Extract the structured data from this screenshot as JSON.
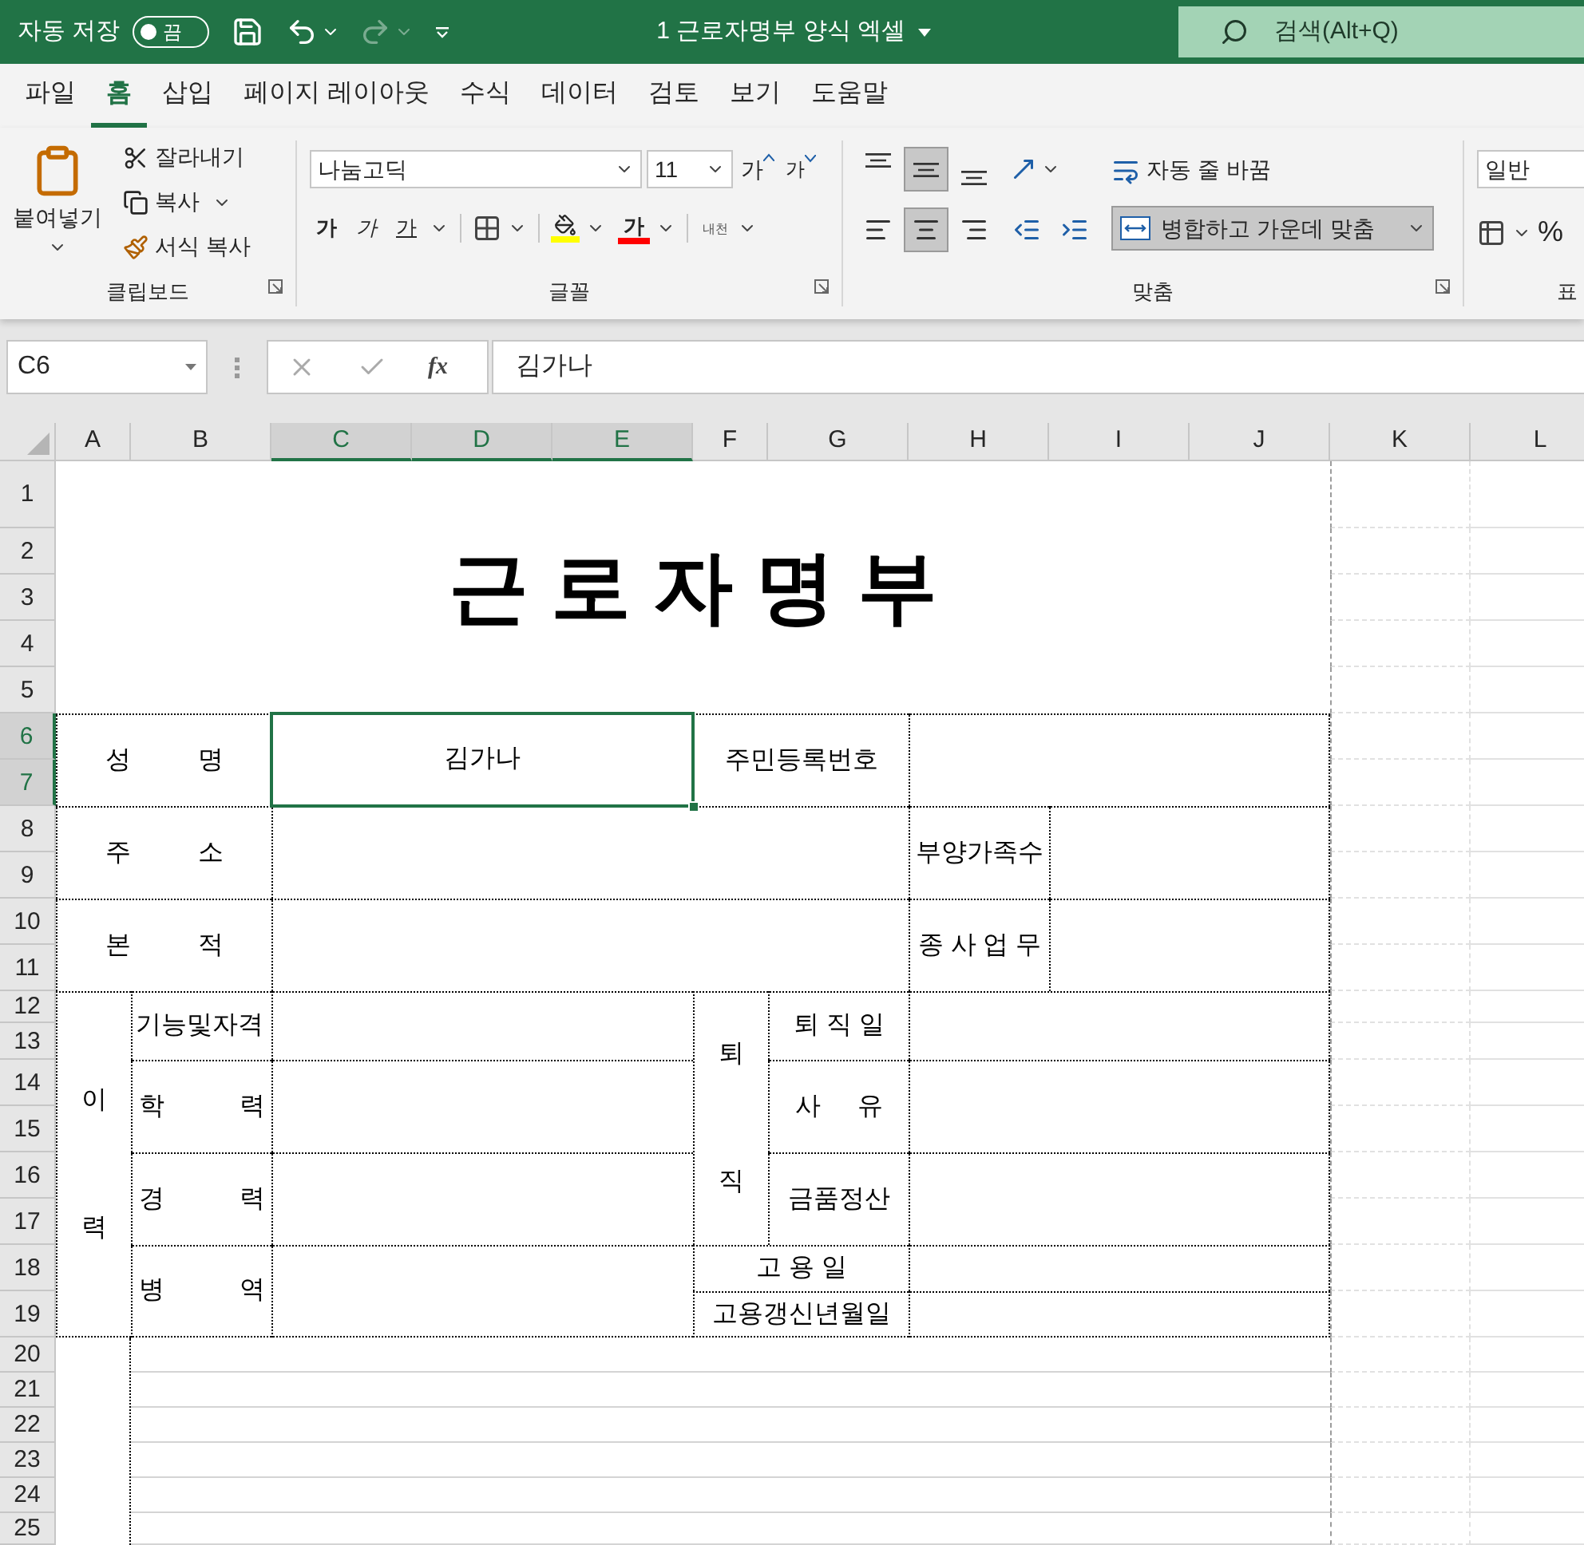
{
  "title_bar": {
    "autosave_label": "자동 저장",
    "autosave": {
      "label": "끔",
      "on": false
    },
    "file_title": "1 근로자명부 양식 엑셀",
    "search_placeholder": "검색(Alt+Q)"
  },
  "menu_tabs": [
    {
      "label": "파일",
      "selected": false
    },
    {
      "label": "홈",
      "selected": true
    },
    {
      "label": "삽입",
      "selected": false
    },
    {
      "label": "페이지 레이아웃",
      "selected": false
    },
    {
      "label": "수식",
      "selected": false
    },
    {
      "label": "데이터",
      "selected": false
    },
    {
      "label": "검토",
      "selected": false
    },
    {
      "label": "보기",
      "selected": false
    },
    {
      "label": "도움말",
      "selected": false
    }
  ],
  "ribbon": {
    "clipboard": {
      "title": "클립보드",
      "paste": "붙여넣기",
      "cut": "잘라내기",
      "copy": "복사",
      "format_painter": "서식 복사"
    },
    "font": {
      "title": "글꼴",
      "font_name": "나눔고딕",
      "font_size": "11",
      "grow": "가",
      "shrink": "가",
      "bold": "가",
      "italic": "가",
      "underline": "가",
      "font_color": "가",
      "phonetic": "내천"
    },
    "alignment": {
      "title": "맞춤",
      "vertical": [
        {
          "kind": "top",
          "selected": false
        },
        {
          "kind": "middle",
          "selected": true
        },
        {
          "kind": "bottom",
          "selected": false
        }
      ],
      "horizontal": [
        {
          "kind": "left",
          "selected": false
        },
        {
          "kind": "center",
          "selected": true
        },
        {
          "kind": "right",
          "selected": false
        }
      ],
      "wrap_text": "자동 줄 바꿈",
      "merge_center": {
        "label": "병합하고 가운데 맞춤",
        "selected": true
      }
    },
    "number": {
      "title": "표",
      "format": "일반",
      "percent": "%"
    }
  },
  "formula_bar": {
    "name_box": "C6",
    "fx": "fx",
    "formula": "김가나"
  },
  "columns": [
    {
      "label": "A",
      "selected": false
    },
    {
      "label": "B",
      "selected": false
    },
    {
      "label": "C",
      "selected": true
    },
    {
      "label": "D",
      "selected": true
    },
    {
      "label": "E",
      "selected": true
    },
    {
      "label": "F",
      "selected": false
    },
    {
      "label": "G",
      "selected": false
    },
    {
      "label": "H",
      "selected": false
    },
    {
      "label": "I",
      "selected": false
    },
    {
      "label": "J",
      "selected": false
    },
    {
      "label": "K",
      "selected": false
    },
    {
      "label": "L",
      "selected": false
    }
  ],
  "rows": [
    {
      "label": "1",
      "selected": false
    },
    {
      "label": "2",
      "selected": false
    },
    {
      "label": "3",
      "selected": false
    },
    {
      "label": "4",
      "selected": false
    },
    {
      "label": "5",
      "selected": false
    },
    {
      "label": "6",
      "selected": true
    },
    {
      "label": "7",
      "selected": true
    },
    {
      "label": "8",
      "selected": false
    },
    {
      "label": "9",
      "selected": false
    },
    {
      "label": "10",
      "selected": false
    },
    {
      "label": "11",
      "selected": false
    },
    {
      "label": "12",
      "selected": false
    },
    {
      "label": "13",
      "selected": false
    },
    {
      "label": "14",
      "selected": false
    },
    {
      "label": "15",
      "selected": false
    },
    {
      "label": "16",
      "selected": false
    },
    {
      "label": "17",
      "selected": false
    },
    {
      "label": "18",
      "selected": false
    },
    {
      "label": "19",
      "selected": false
    },
    {
      "label": "20",
      "selected": false
    },
    {
      "label": "21",
      "selected": false
    },
    {
      "label": "22",
      "selected": false
    },
    {
      "label": "23",
      "selected": false
    },
    {
      "label": "24",
      "selected": false
    },
    {
      "label": "25",
      "selected": false
    }
  ],
  "sheet_title": "근로자명부",
  "cells": [
    {
      "text": "성 명",
      "selected": false
    },
    {
      "text": "김가나",
      "selected": true
    },
    {
      "text": "주민등록번호",
      "selected": false
    },
    {
      "selected": false
    },
    {
      "text": "주 소",
      "selected": false
    },
    {
      "selected": false
    },
    {
      "text": "부양가족수",
      "selected": false
    },
    {
      "selected": false
    },
    {
      "text": "본 적",
      "selected": false
    },
    {
      "selected": false
    },
    {
      "text": "종 사 업 무",
      "selected": false
    },
    {
      "selected": false
    },
    {
      "text": "이력",
      "selected": false
    },
    {
      "text": "기능및자격",
      "selected": false
    },
    {
      "selected": false
    },
    {
      "text": "퇴직",
      "selected": false
    },
    {
      "text": "퇴 직 일",
      "selected": false
    },
    {
      "selected": false
    },
    {
      "text": "학 력",
      "selected": false
    },
    {
      "selected": false
    },
    {
      "text": "사 유",
      "selected": false
    },
    {
      "selected": false
    },
    {
      "text": "경 력",
      "selected": false
    },
    {
      "selected": false
    },
    {
      "text": "금품정산",
      "selected": false
    },
    {
      "selected": false
    },
    {
      "text": "병 역",
      "selected": false
    },
    {
      "selected": false
    },
    {
      "text": "고 용 일",
      "selected": false
    },
    {
      "selected": false
    },
    {
      "text": "고용갱신년월일",
      "selected": false
    },
    {
      "selected": false
    }
  ]
}
